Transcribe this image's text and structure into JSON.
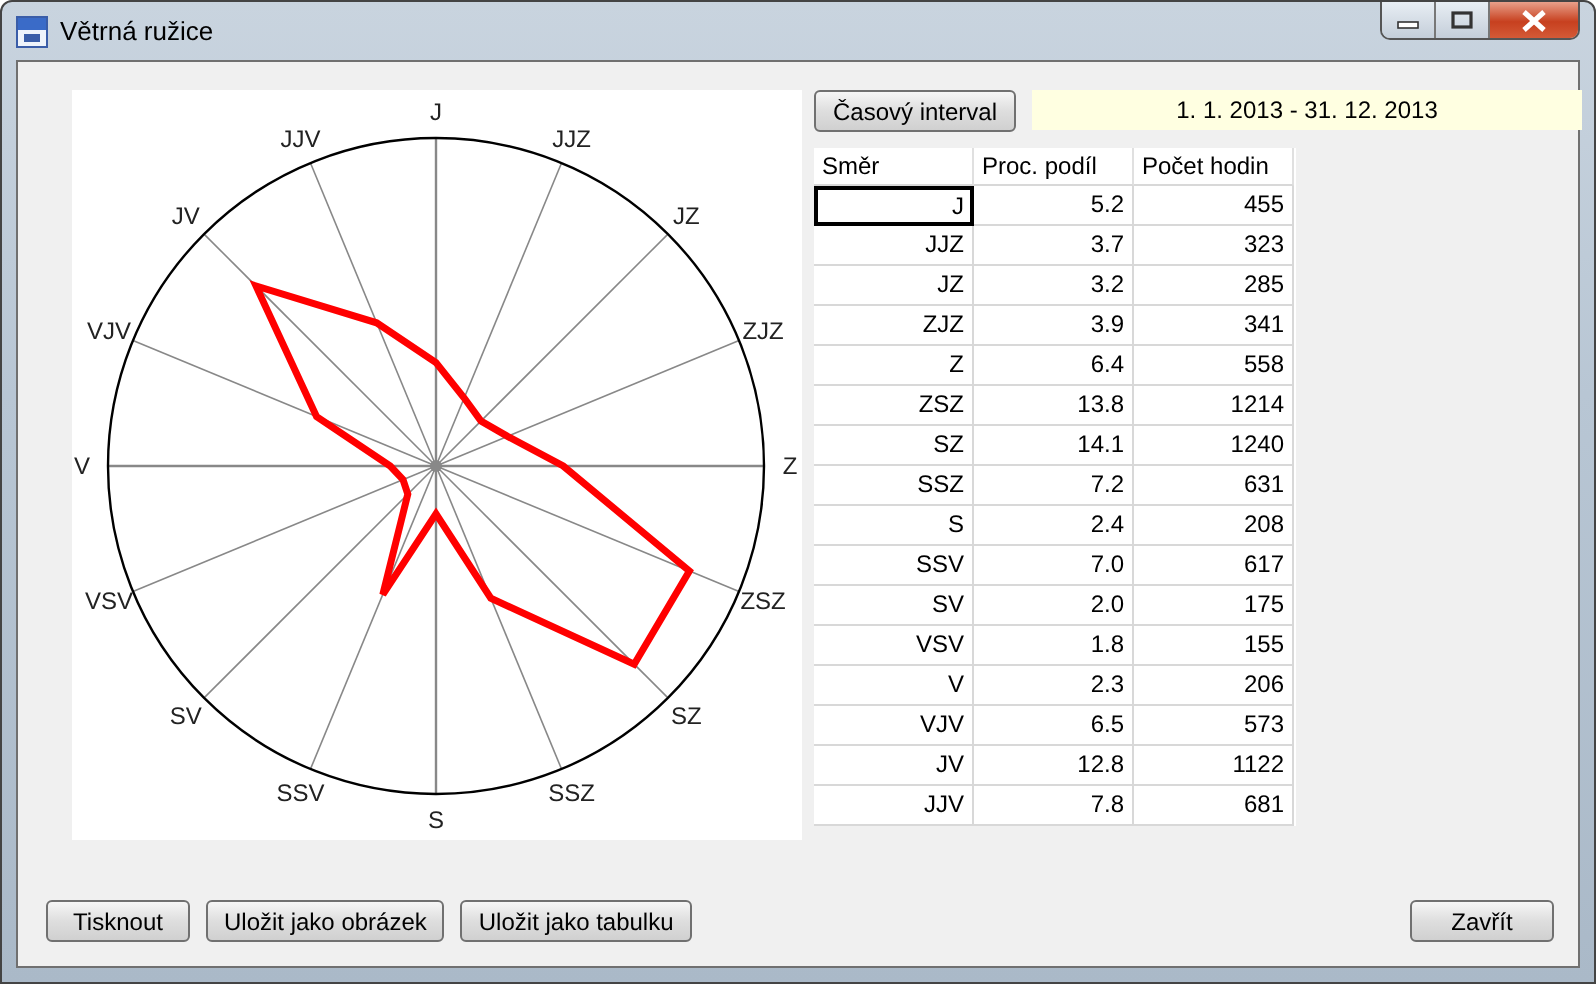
{
  "window": {
    "title": "Větrná ružice"
  },
  "chart": {
    "direction_labels": [
      "J",
      "JJZ",
      "JZ",
      "ZJZ",
      "Z",
      "ZSZ",
      "SZ",
      "SSZ",
      "S",
      "SSV",
      "SV",
      "VSV",
      "V",
      "VJV",
      "JV",
      "JJV"
    ]
  },
  "interval_button": "Časový interval",
  "date_range": {
    "value": "1. 1. 2013 - 31. 12. 2013"
  },
  "table": {
    "columns": [
      "Směr",
      "Proc. podíl",
      "Počet hodin"
    ],
    "rows": [
      {
        "direction": "J",
        "share": "5.2",
        "hours": "455",
        "selected": true
      },
      {
        "direction": "JJZ",
        "share": "3.7",
        "hours": "323",
        "selected": false
      },
      {
        "direction": "JZ",
        "share": "3.2",
        "hours": "285",
        "selected": false
      },
      {
        "direction": "ZJZ",
        "share": "3.9",
        "hours": "341",
        "selected": false
      },
      {
        "direction": "Z",
        "share": "6.4",
        "hours": "558",
        "selected": false
      },
      {
        "direction": "ZSZ",
        "share": "13.8",
        "hours": "1214",
        "selected": false
      },
      {
        "direction": "SZ",
        "share": "14.1",
        "hours": "1240",
        "selected": false
      },
      {
        "direction": "SSZ",
        "share": "7.2",
        "hours": "631",
        "selected": false
      },
      {
        "direction": "S",
        "share": "2.4",
        "hours": "208",
        "selected": false
      },
      {
        "direction": "SSV",
        "share": "7.0",
        "hours": "617",
        "selected": false
      },
      {
        "direction": "SV",
        "share": "2.0",
        "hours": "175",
        "selected": false
      },
      {
        "direction": "VSV",
        "share": "1.8",
        "hours": "155",
        "selected": false
      },
      {
        "direction": "V",
        "share": "2.3",
        "hours": "206",
        "selected": false
      },
      {
        "direction": "VJV",
        "share": "6.5",
        "hours": "573",
        "selected": false
      },
      {
        "direction": "JV",
        "share": "12.8",
        "hours": "1122",
        "selected": false
      },
      {
        "direction": "JJV",
        "share": "7.8",
        "hours": "681",
        "selected": false
      }
    ]
  },
  "buttons": [
    "Tisknout",
    "Uložit jako obrázek",
    "Uložit jako tabulku"
  ],
  "close_button": "Zavřít"
}
